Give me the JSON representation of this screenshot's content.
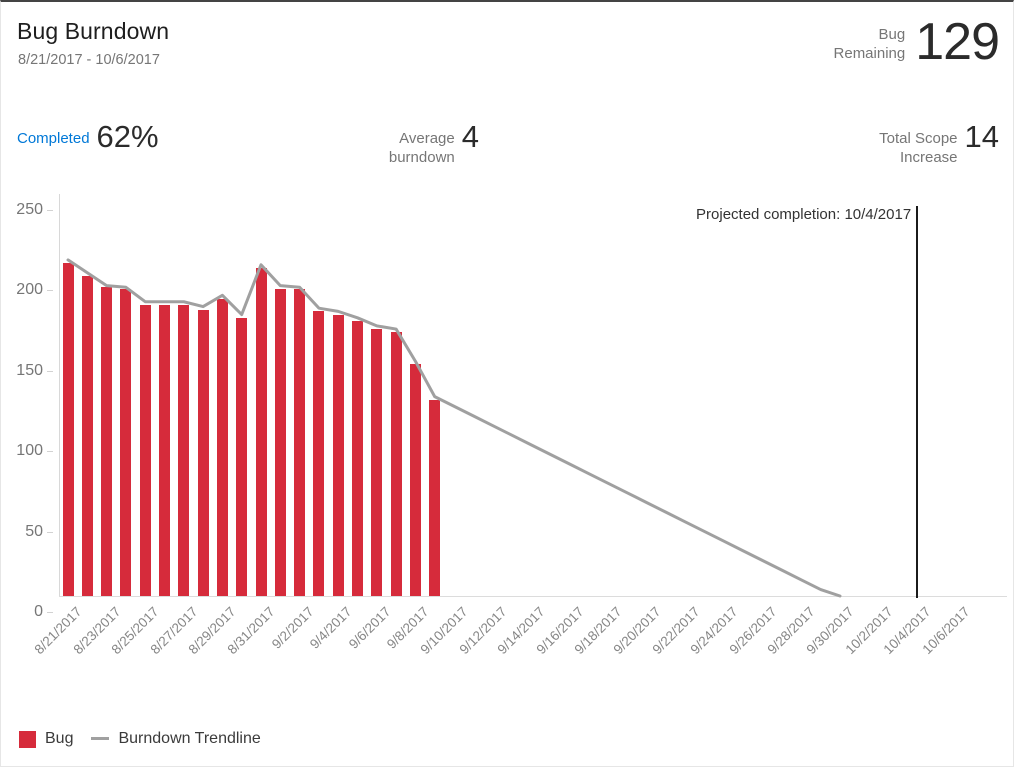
{
  "header": {
    "title": "Bug Burndown",
    "date_range": "8/21/2017 - 10/6/2017",
    "primary_kpi": {
      "label_line1": "Bug",
      "label_line2": "Remaining",
      "value": "129"
    }
  },
  "kpis": [
    {
      "name": "completed",
      "label_line1": "Completed",
      "label_line2": "",
      "value": "62%",
      "is_link": true
    },
    {
      "name": "average-burndown",
      "label_line1": "Average",
      "label_line2": "burndown",
      "value": "4",
      "is_link": false
    },
    {
      "name": "total-scope-increase",
      "label_line1": "Total Scope",
      "label_line2": "Increase",
      "value": "14",
      "is_link": false
    }
  ],
  "annotation": {
    "projected_completion": "Projected completion: 10/4/2017",
    "projected_date": "10/4/2017"
  },
  "legend": [
    {
      "name": "bug",
      "label": "Bug",
      "marker": "square",
      "color": "#d62b3b"
    },
    {
      "name": "burndown-trendline",
      "label": "Burndown Trendline",
      "marker": "line",
      "color": "#a0a0a0"
    }
  ],
  "colors": {
    "bar": "#d62b3b",
    "trendline": "#a0a0a0",
    "link": "#0078d7",
    "projection_marker": "#1b1b1b"
  },
  "chart_data": {
    "type": "bar",
    "title": "Bug Burndown",
    "xlabel": "",
    "ylabel": "",
    "ylim": [
      0,
      250
    ],
    "yticks": [
      0,
      50,
      100,
      150,
      200,
      250
    ],
    "grid": false,
    "legend_position": "bottom-left",
    "x_tick_labels": [
      "8/21/2017",
      "8/23/2017",
      "8/25/2017",
      "8/27/2017",
      "8/29/2017",
      "8/31/2017",
      "9/2/2017",
      "9/4/2017",
      "9/6/2017",
      "9/8/2017",
      "9/10/2017",
      "9/12/2017",
      "9/14/2017",
      "9/16/2017",
      "9/18/2017",
      "9/20/2017",
      "9/22/2017",
      "9/24/2017",
      "9/26/2017",
      "9/28/2017",
      "9/30/2017",
      "10/2/2017",
      "10/4/2017",
      "10/6/2017"
    ],
    "categories": [
      "8/21/2017",
      "8/22/2017",
      "8/23/2017",
      "8/24/2017",
      "8/25/2017",
      "8/26/2017",
      "8/27/2017",
      "8/28/2017",
      "8/29/2017",
      "8/30/2017",
      "8/31/2017",
      "9/1/2017",
      "9/2/2017",
      "9/3/2017",
      "9/4/2017",
      "9/5/2017",
      "9/6/2017",
      "9/7/2017",
      "9/8/2017",
      "9/9/2017",
      "9/10/2017",
      "9/11/2017",
      "9/12/2017",
      "9/13/2017",
      "9/14/2017",
      "9/15/2017",
      "9/16/2017",
      "9/17/2017",
      "9/18/2017",
      "9/19/2017",
      "9/20/2017",
      "9/21/2017",
      "9/22/2017",
      "9/23/2017",
      "9/24/2017",
      "9/25/2017",
      "9/26/2017",
      "9/27/2017",
      "9/28/2017",
      "9/29/2017",
      "9/30/2017",
      "10/1/2017",
      "10/2/2017",
      "10/3/2017",
      "10/4/2017",
      "10/5/2017",
      "10/6/2017"
    ],
    "series": [
      {
        "name": "Bug",
        "type": "bar",
        "color": "#d62b3b",
        "values": [
          207,
          199,
          192,
          191,
          181,
          181,
          181,
          178,
          185,
          173,
          204,
          191,
          191,
          177,
          175,
          171,
          166,
          164,
          144,
          122,
          null,
          null,
          null,
          null,
          null,
          null,
          null,
          null,
          null,
          null,
          null,
          null,
          null,
          null,
          null,
          null,
          null,
          null,
          null,
          null,
          null,
          null,
          null,
          null,
          null,
          null,
          null
        ]
      },
      {
        "name": "Burndown Trendline",
        "type": "line",
        "color": "#a0a0a0",
        "values": [
          209,
          201,
          193,
          192,
          183,
          183,
          183,
          180,
          187,
          175,
          206,
          193,
          192,
          179,
          177,
          173,
          168,
          166,
          146,
          124,
          118,
          112,
          106,
          100,
          94,
          88,
          82,
          76,
          70,
          64,
          58,
          52,
          46,
          40,
          34,
          28,
          22,
          16,
          10,
          4,
          0,
          null,
          null,
          null,
          null,
          null,
          null
        ]
      }
    ],
    "projection": {
      "start_category": "9/9/2017",
      "start_value": 124,
      "end_category": "10/4/2017",
      "end_value": 0
    }
  }
}
